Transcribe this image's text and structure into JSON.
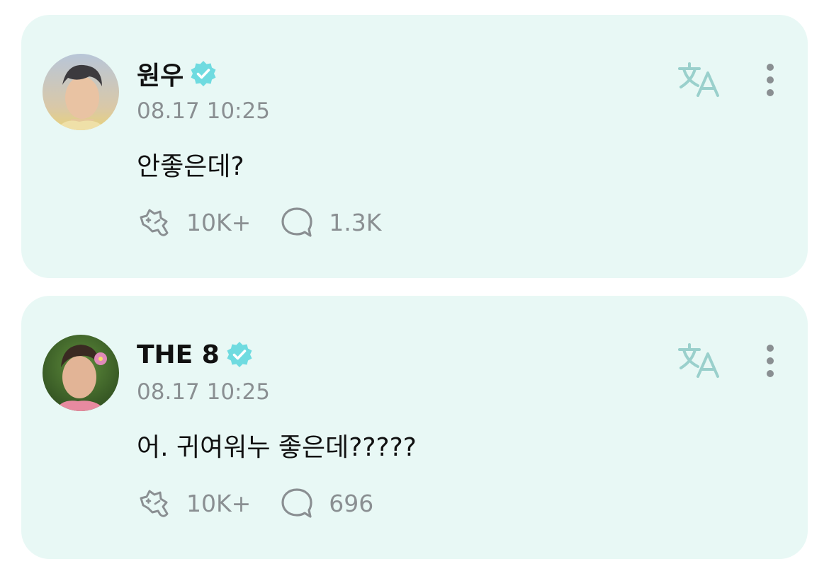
{
  "colors": {
    "card_background": "#e8f8f5",
    "verified_badge": "#6fdbe0",
    "icon_gray": "#8a8f92",
    "translate_icon": "#9ad0cc"
  },
  "posts": [
    {
      "author": "원우",
      "verified": true,
      "timestamp": "08.17 10:25",
      "text": "안좋은데?",
      "reactions": "10K+",
      "comments": "1.3K",
      "avatar": "avatar-photo"
    },
    {
      "author": "THE 8",
      "verified": true,
      "timestamp": "08.17 10:25",
      "text": "어. 귀여워누 좋은데?????",
      "reactions": "10K+",
      "comments": "696",
      "avatar": "avatar-photo"
    }
  ],
  "icons": {
    "verified": "verified-badge-icon",
    "translate": "translate-icon",
    "more": "more-vertical-icon",
    "reaction": "reaction-icon",
    "comment": "comment-icon"
  }
}
